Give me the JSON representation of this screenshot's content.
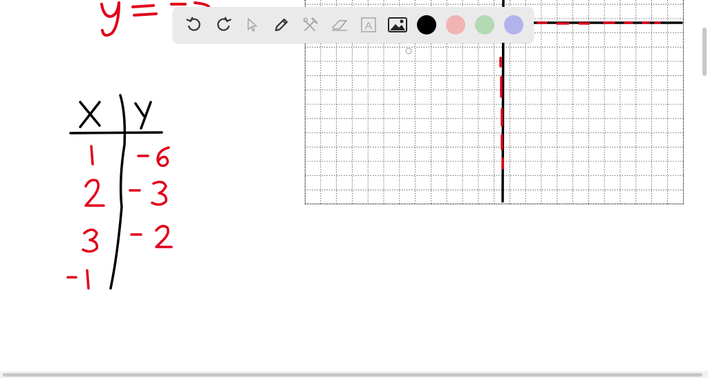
{
  "toolbar": {
    "tools": [
      {
        "name": "undo-icon"
      },
      {
        "name": "redo-icon"
      },
      {
        "name": "select-cursor-icon"
      },
      {
        "name": "pen-icon"
      },
      {
        "name": "tools-icon"
      },
      {
        "name": "eraser-icon"
      },
      {
        "name": "text-box-icon",
        "glyph": "A"
      },
      {
        "name": "image-icon"
      }
    ],
    "colors": [
      "#000000",
      "#f2b3b3",
      "#b3d9b3",
      "#b3b3ec"
    ]
  },
  "handwriting": {
    "equation_top": "y = −6",
    "table_header_x": "X",
    "table_header_y": "Y",
    "table_x_values": [
      "1",
      "2",
      "3",
      "-1"
    ],
    "table_y_values": [
      "-6",
      "-3",
      "-2"
    ]
  },
  "ink_colors": {
    "red": "#e0001a",
    "black": "#000000"
  }
}
